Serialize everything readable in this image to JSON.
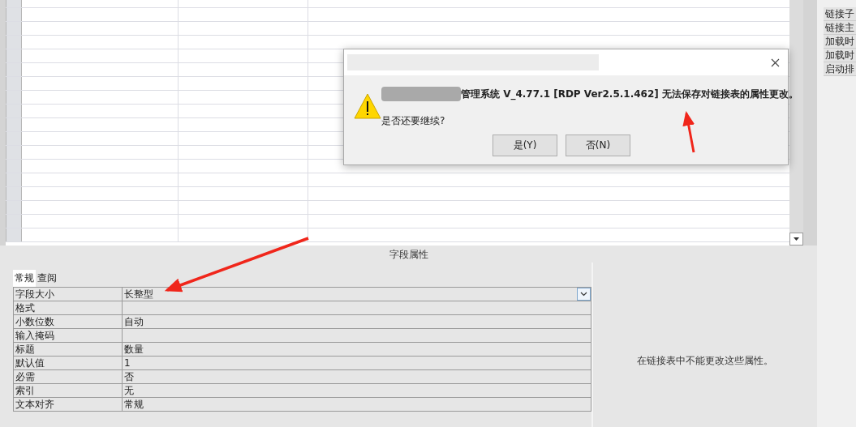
{
  "dialog": {
    "message": "管理系统 V_4.77.1 [RDP Ver2.5.1.462] 无法保存对链接表的属性更改。",
    "question": "是否还要继续?",
    "buttons": [
      {
        "label": "是(Y)"
      },
      {
        "label": "否(N)"
      }
    ]
  },
  "field_properties": {
    "title": "字段属性",
    "tabs": [
      {
        "label": "常规",
        "selected": true
      },
      {
        "label": "查阅",
        "selected": false
      }
    ],
    "properties": [
      {
        "label": "字段大小",
        "value": "长整型",
        "kind": "dropdown"
      },
      {
        "label": "格式",
        "kind": "text"
      },
      {
        "label": "小数位数",
        "value": "自动",
        "kind": "text"
      },
      {
        "label": "输入掩码",
        "kind": "text"
      },
      {
        "label": "标题",
        "value": "数量",
        "kind": "text"
      },
      {
        "label": "默认值",
        "value": "1",
        "kind": "text"
      },
      {
        "label": "必需",
        "value": "否",
        "kind": "text"
      },
      {
        "label": "索引",
        "value": "无",
        "kind": "text"
      },
      {
        "label": "文本对齐",
        "value": "常规",
        "kind": "text"
      }
    ],
    "help_text": "在链接表中不能更改这些属性。"
  },
  "side_list": {
    "items": [
      "链接子",
      "链接主",
      "加载时",
      "加载时",
      "启动排"
    ]
  }
}
